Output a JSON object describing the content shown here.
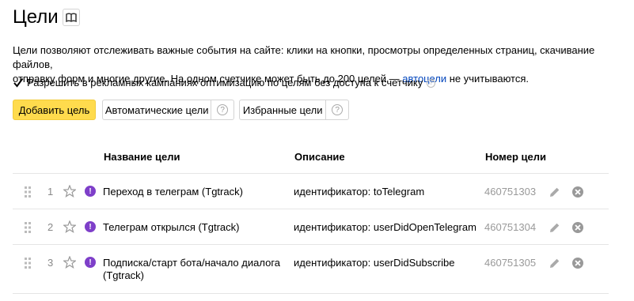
{
  "page": {
    "title": "Цели",
    "book_icon": "book-icon"
  },
  "intro": {
    "text_line1": "Цели позволяют отслеживать важные события на сайте: клики на кнопки, просмотры определенных страниц, скачивание файлов,",
    "text_line2_before": "отправку форм и многие другие. На одном счетчике может быть до 200 целей — ",
    "link_text": "автоцели",
    "text_line2_after": " не учитываются."
  },
  "checkbox": {
    "checked": true,
    "label": "Разрешить в рекламных кампаниях оптимизацию по целям без доступа к счетчику"
  },
  "toolbar": {
    "add_label": "Добавить цель",
    "auto_label": "Автоматические цели",
    "fav_label": "Избранные цели",
    "help_glyph": "?"
  },
  "table": {
    "headers": {
      "name": "Название цели",
      "description": "Описание",
      "id": "Номер цели"
    },
    "rows": [
      {
        "index": "1",
        "name": "Переход в телеграм (Tgtrack)",
        "name2": "",
        "description": "идентификатор: toTelegram",
        "goal_id": "460751303"
      },
      {
        "index": "2",
        "name": "Телеграм открылся (Tgtrack)",
        "name2": "",
        "description": "идентификатор: userDidOpenTelegram",
        "goal_id": "460751304"
      },
      {
        "index": "3",
        "name": "Подписка/старт бота/начало диалога",
        "name2": "(Tgtrack)",
        "description": "идентификатор: userDidSubscribe",
        "goal_id": "460751305"
      }
    ]
  },
  "colors": {
    "accent_yellow": "#ffdb4d",
    "link_blue": "#0044bb",
    "warning_purple": "#7e3fc9"
  }
}
